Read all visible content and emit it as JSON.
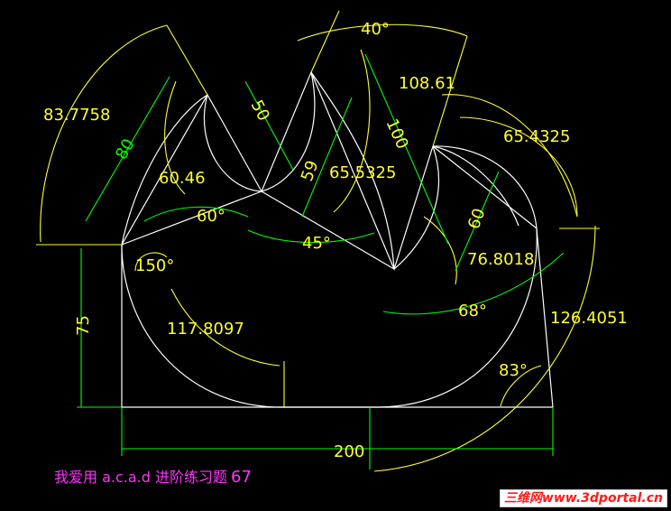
{
  "labels": {
    "top_angle": "40°",
    "arc_83_7758": "83.7758",
    "dim_80": "80",
    "dim_50": "50",
    "dim_100": "100",
    "dim_108_61": "108.61",
    "dim_65_4325": "65.4325",
    "dim_60_46": "60.46",
    "dim_65_5325": "65.5325",
    "dim_59": "59",
    "dim_60": "60",
    "angle_60": "60°",
    "angle_45": "45°",
    "dim_76_8018": "76.8018",
    "angle_150": "150°",
    "dim_117_8097": "117.8097",
    "angle_68": "68°",
    "dim_126_4051": "126.4051",
    "dim_75": "75",
    "angle_83": "83°",
    "dim_200": "200"
  },
  "caption": {
    "text": "我爱用 a.c.a.d  进阶练习题",
    "number": "67"
  },
  "watermark": "三维网www.3dportal.cn",
  "colors": {
    "background": "#000000",
    "geometry": "#ffffff",
    "dimension_yellow": "#ffff33",
    "dimension_green": "#00ff00",
    "caption": "#ff33ff",
    "watermark": "#ff1a1a"
  }
}
